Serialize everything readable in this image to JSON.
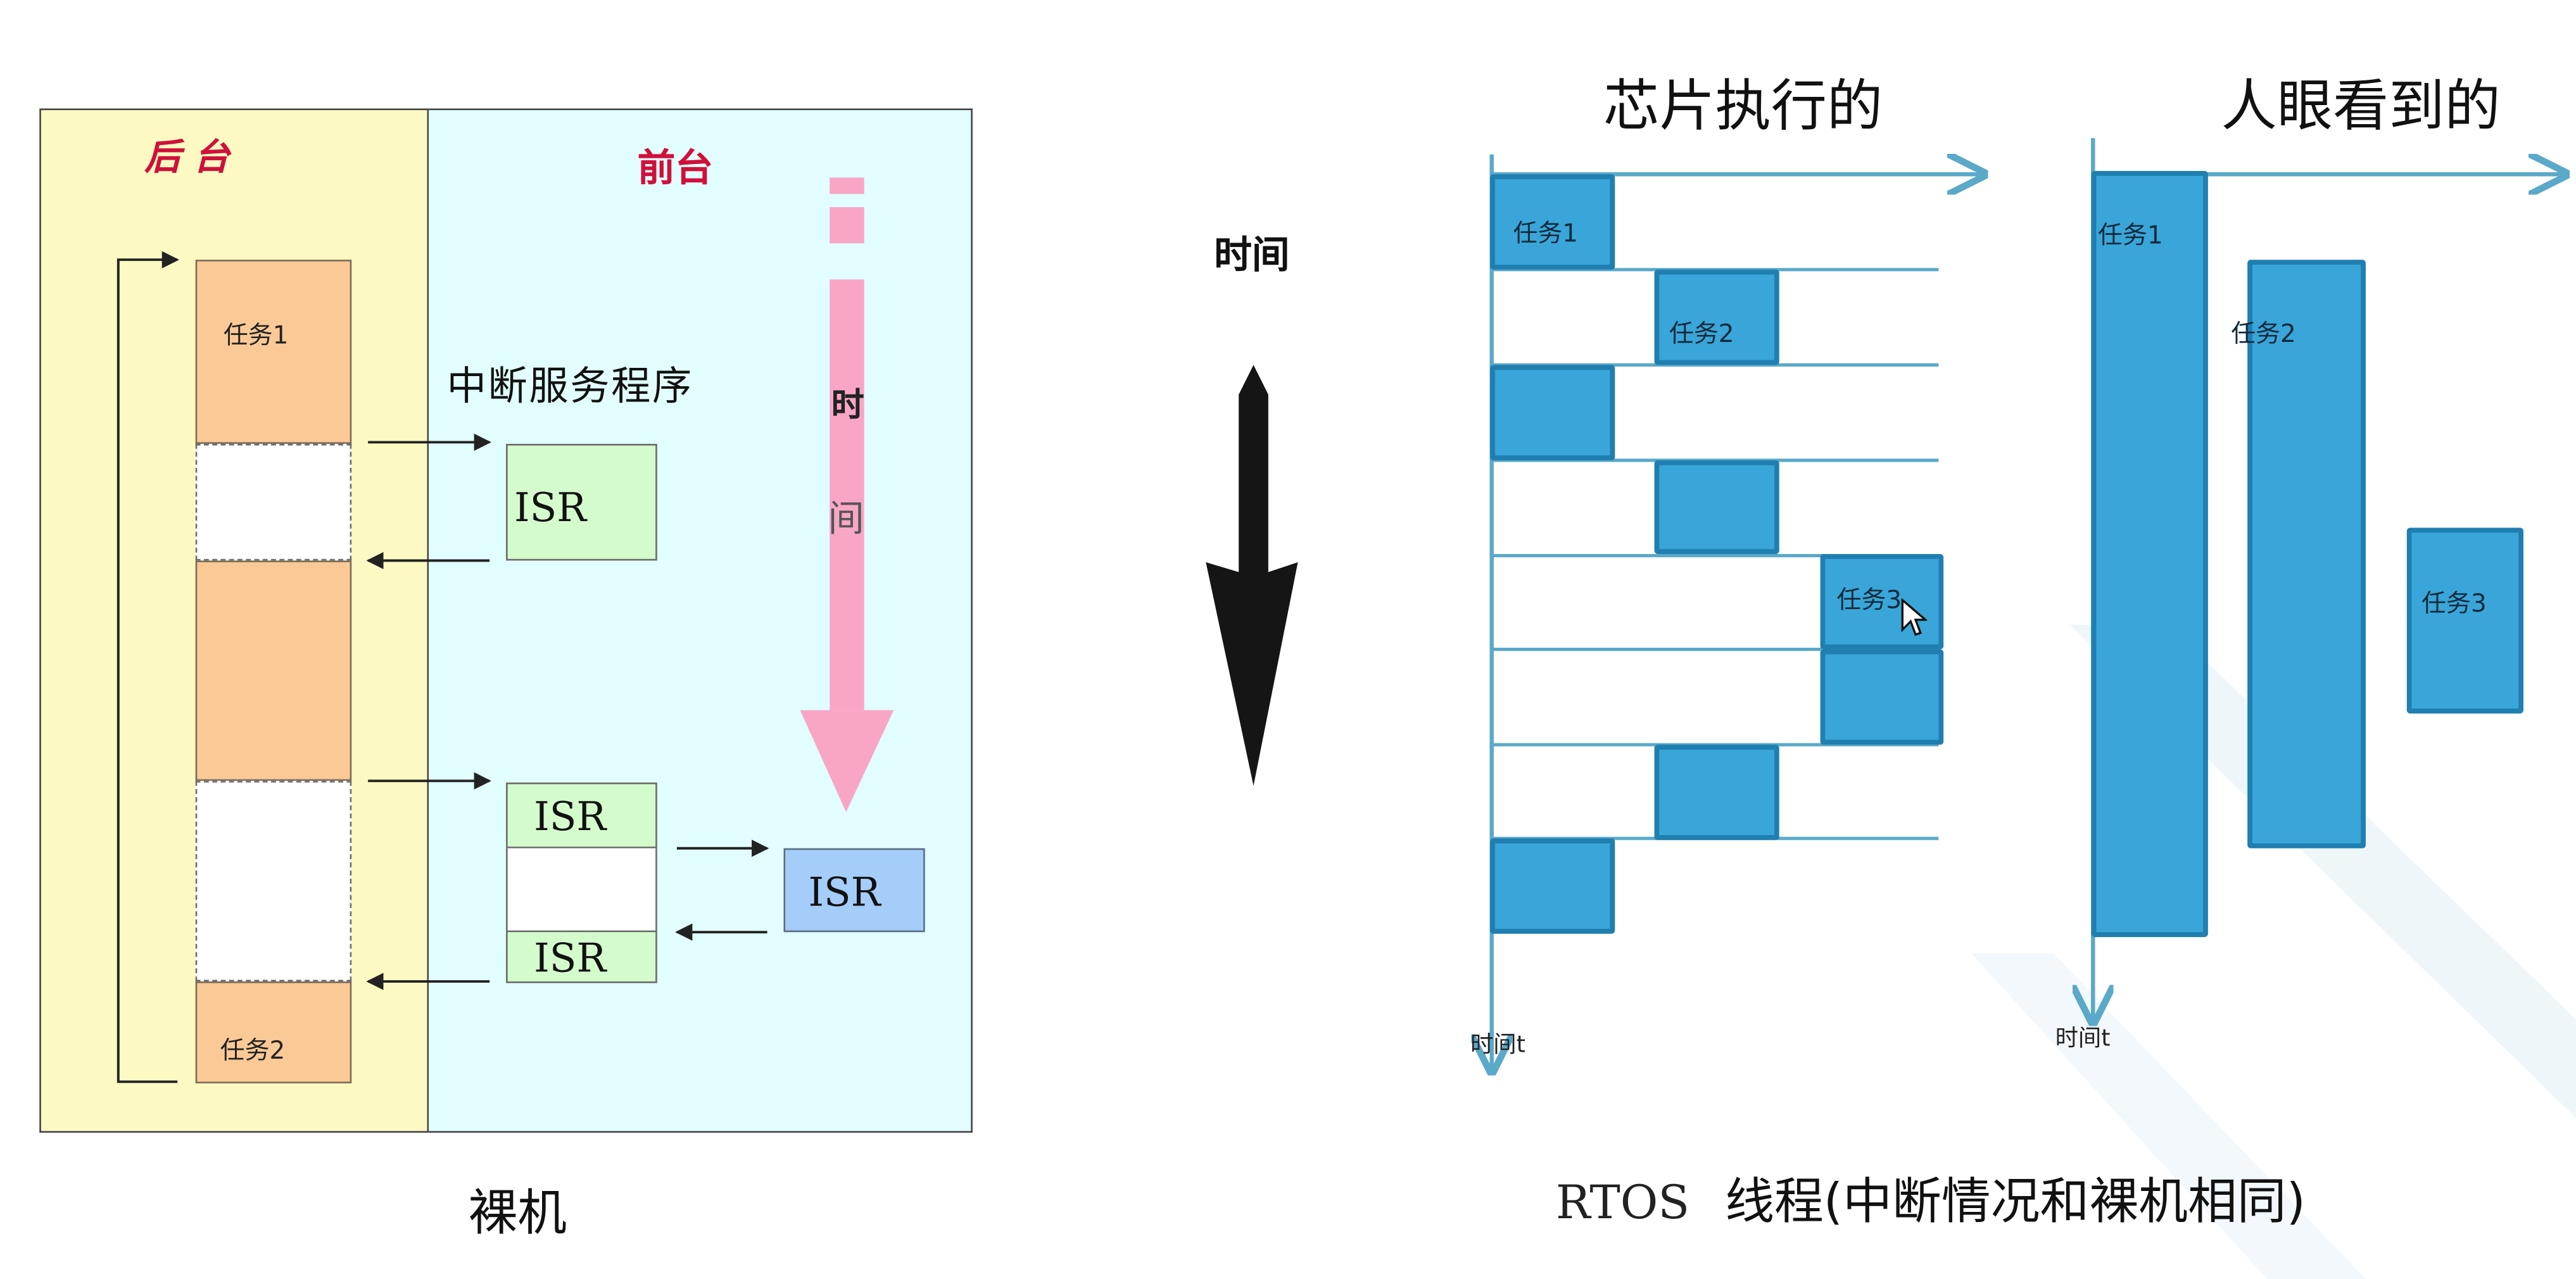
{
  "left": {
    "back_label": "后 台",
    "front_label": "前台",
    "tasks": [
      "任务1",
      "任务2"
    ],
    "isr_service_label": "中断服务程序",
    "isr": [
      "ISR",
      "ISR",
      "ISR",
      "ISR"
    ],
    "time_chars": [
      "时",
      "间"
    ],
    "caption": "裸机"
  },
  "middle": {
    "time_label": "时间"
  },
  "right": {
    "chip_heading": "芯片执行的",
    "eye_heading": "人眼看到的",
    "task_labels": [
      "任务1",
      "任务2",
      "任务3"
    ],
    "axis_label_left": "时间t",
    "axis_label_right": "时间t",
    "caption_prefix": "RTOS",
    "caption_main": "线程(中断情况和裸机相同)"
  },
  "colors": {
    "back_bg": "#fdf9c3",
    "front_bg": "#e1fdfd",
    "task_orange": "#fbc996",
    "isr_green": "#d4fbcc",
    "isr_blue": "#a5cdf9",
    "time_arrow_pink": "#f9a6c6",
    "rtos_blue": "#3aa5d8",
    "rtos_axis": "#5aa9c9",
    "label_red": "#d0103a"
  }
}
